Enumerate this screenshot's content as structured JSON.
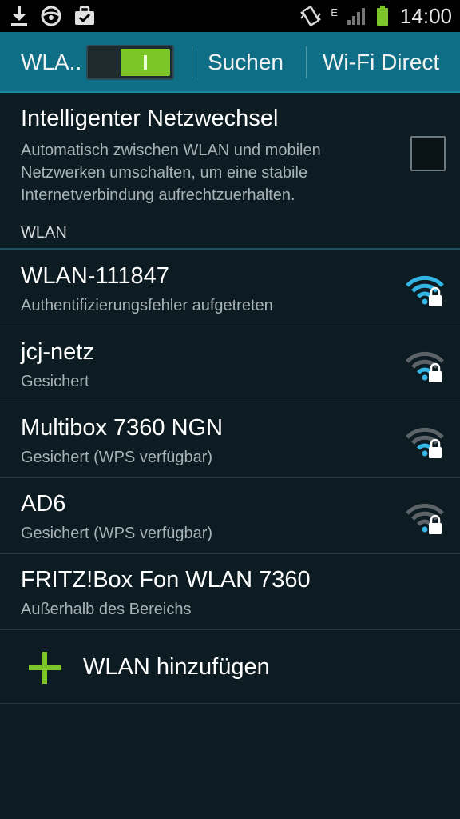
{
  "status_bar": {
    "icons_left": [
      "download-icon",
      "steering-wheel-icon",
      "briefcase-check-icon"
    ],
    "icons_right": [
      "vibrate-icon",
      "network-type-e-icon",
      "signal-icon",
      "battery-icon"
    ],
    "network_type": "E",
    "time": "14:00"
  },
  "action_bar": {
    "wlan_label": "WLA..",
    "wlan_enabled": true,
    "search_label": "Suchen",
    "wifi_direct_label": "Wi-Fi Direct"
  },
  "smart_switch": {
    "title": "Intelligenter Netzwechsel",
    "description": "Automatisch zwischen WLAN und mobilen Netzwerken umschalten, um eine stabile Internetverbindung aufrechtzuerhalten.",
    "checked": false
  },
  "section": {
    "header": "WLAN"
  },
  "networks": [
    {
      "name": "WLAN-111847",
      "status": "Authentifizierungsfehler aufgetreten",
      "signal_bars": 3,
      "locked": true,
      "color": "#33b5e5"
    },
    {
      "name": "jcj-netz",
      "status": "Gesichert",
      "signal_bars": 1,
      "locked": true,
      "color": "#33b5e5"
    },
    {
      "name": "Multibox 7360 NGN",
      "status": "Gesichert (WPS verfügbar)",
      "signal_bars": 1,
      "locked": true,
      "color": "#33b5e5"
    },
    {
      "name": "AD6",
      "status": "Gesichert (WPS verfügbar)",
      "signal_bars": 0,
      "locked": true,
      "color": "#33b5e5"
    },
    {
      "name": "FRITZ!Box Fon WLAN 7360",
      "status": "Außerhalb des Bereichs",
      "signal_bars": null,
      "locked": false
    }
  ],
  "add_network": {
    "label": "WLAN hinzufügen",
    "icon": "plus-icon"
  },
  "colors": {
    "accent": "#33b5e5",
    "action_bar": "#0e6e86",
    "toggle_on": "#7cc629",
    "background": "#0c1c22"
  }
}
